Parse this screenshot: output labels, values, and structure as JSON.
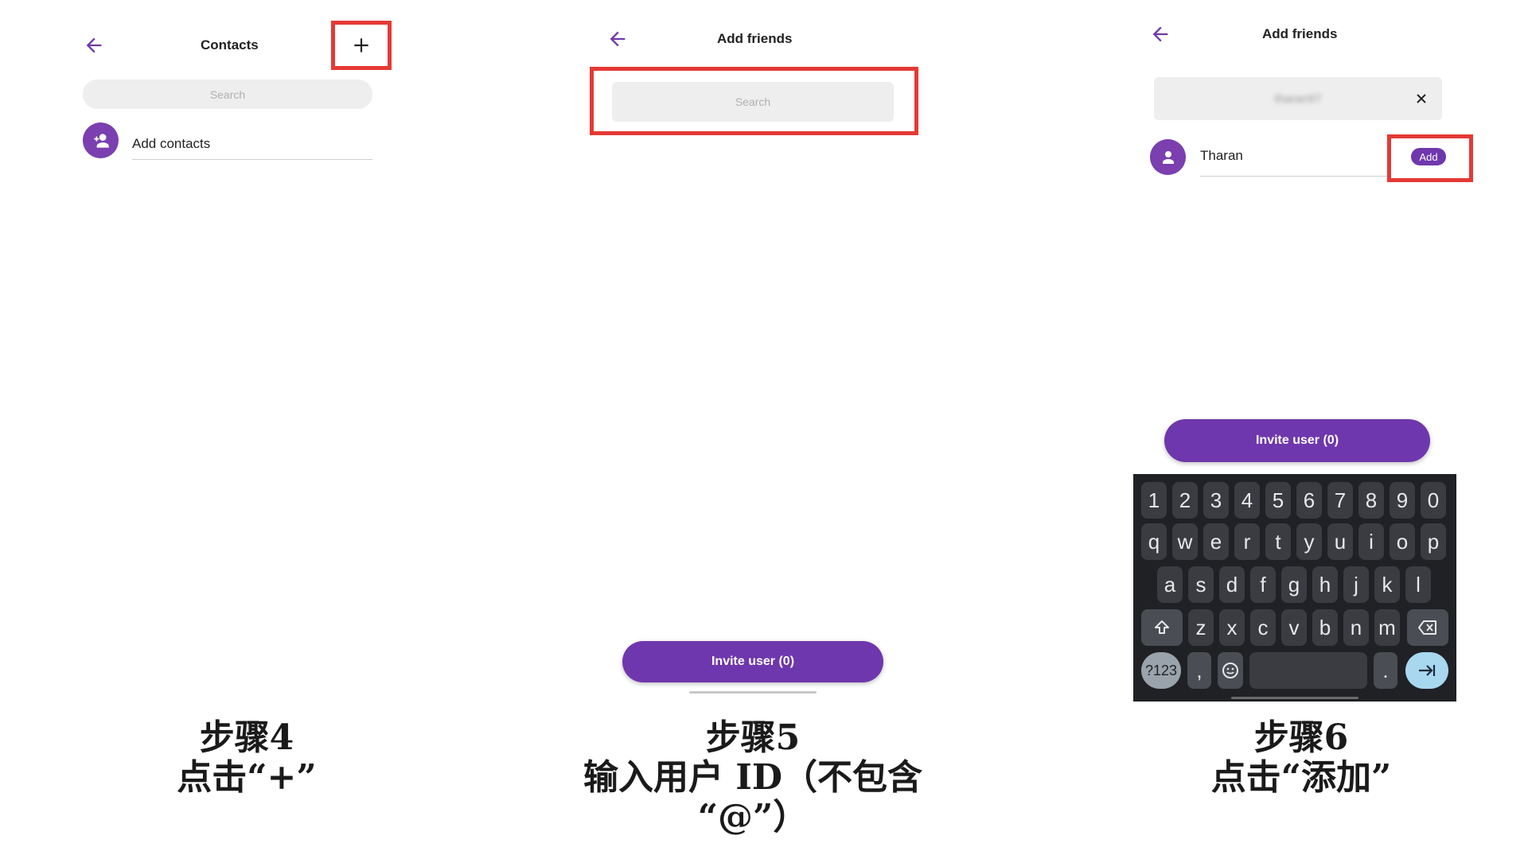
{
  "panel1": {
    "title": "Contacts",
    "search_placeholder": "Search",
    "add_contacts_label": "Add contacts",
    "caption_line1": "步骤4",
    "caption_line2": "点击“+”"
  },
  "panel2": {
    "title": "Add friends",
    "search_placeholder": "Search",
    "invite_button": "Invite user (0)",
    "caption_line1": "步骤5",
    "caption_line2": "输入用户 ID（不包含",
    "caption_line3": "“@”）"
  },
  "panel3": {
    "title": "Add friends",
    "search_value": "tharan97",
    "result_name": "Tharan",
    "add_button": "Add",
    "invite_button": "Invite user (0)",
    "caption_line1": "步骤6",
    "caption_line2": "点击“添加”",
    "keyboard": {
      "row1": [
        "1",
        "2",
        "3",
        "4",
        "5",
        "6",
        "7",
        "8",
        "9",
        "0"
      ],
      "row2": [
        "q",
        "w",
        "e",
        "r",
        "t",
        "y",
        "u",
        "i",
        "o",
        "p"
      ],
      "row3": [
        "a",
        "s",
        "d",
        "f",
        "g",
        "h",
        "j",
        "k",
        "l"
      ],
      "row4": [
        "z",
        "x",
        "c",
        "v",
        "b",
        "n",
        "m"
      ],
      "symbols_key": "?123",
      "comma_key": ",",
      "period_key": "."
    }
  },
  "colors": {
    "accent": "#6f37ad",
    "highlight": "#e53935"
  }
}
